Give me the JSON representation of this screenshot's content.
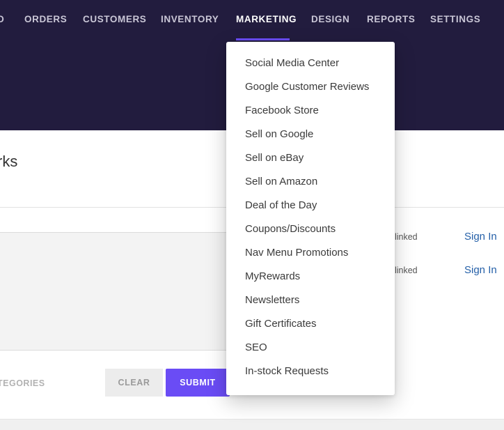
{
  "nav": {
    "items": [
      {
        "label": "D",
        "active": false
      },
      {
        "label": "ORDERS",
        "active": false
      },
      {
        "label": "CUSTOMERS",
        "active": false
      },
      {
        "label": "INVENTORY",
        "active": false
      },
      {
        "label": "MARKETING",
        "active": true
      },
      {
        "label": "DESIGN",
        "active": false
      },
      {
        "label": "REPORTS",
        "active": false
      },
      {
        "label": "SETTINGS",
        "active": false
      }
    ]
  },
  "page": {
    "title": "rks"
  },
  "accounts": [
    {
      "status": "t linked",
      "action": "Sign In"
    },
    {
      "status": "t linked",
      "action": "Sign In"
    }
  ],
  "actions": {
    "categories_label": "TEGORIES",
    "clear_label": "CLEAR",
    "submit_label": "SUBMIT"
  },
  "marketing_menu": {
    "items": [
      "Social Media Center",
      "Google Customer Reviews",
      "Facebook Store",
      "Sell on Google",
      "Sell on eBay",
      "Sell on Amazon",
      "Deal of the Day",
      "Coupons/Discounts",
      "Nav Menu Promotions",
      "MyRewards",
      "Newsletters",
      "Gift Certificates",
      "SEO",
      "In-stock Requests"
    ]
  },
  "colors": {
    "header_bg": "#221c3e",
    "accent": "#6a4cf5",
    "link": "#2560a8"
  }
}
